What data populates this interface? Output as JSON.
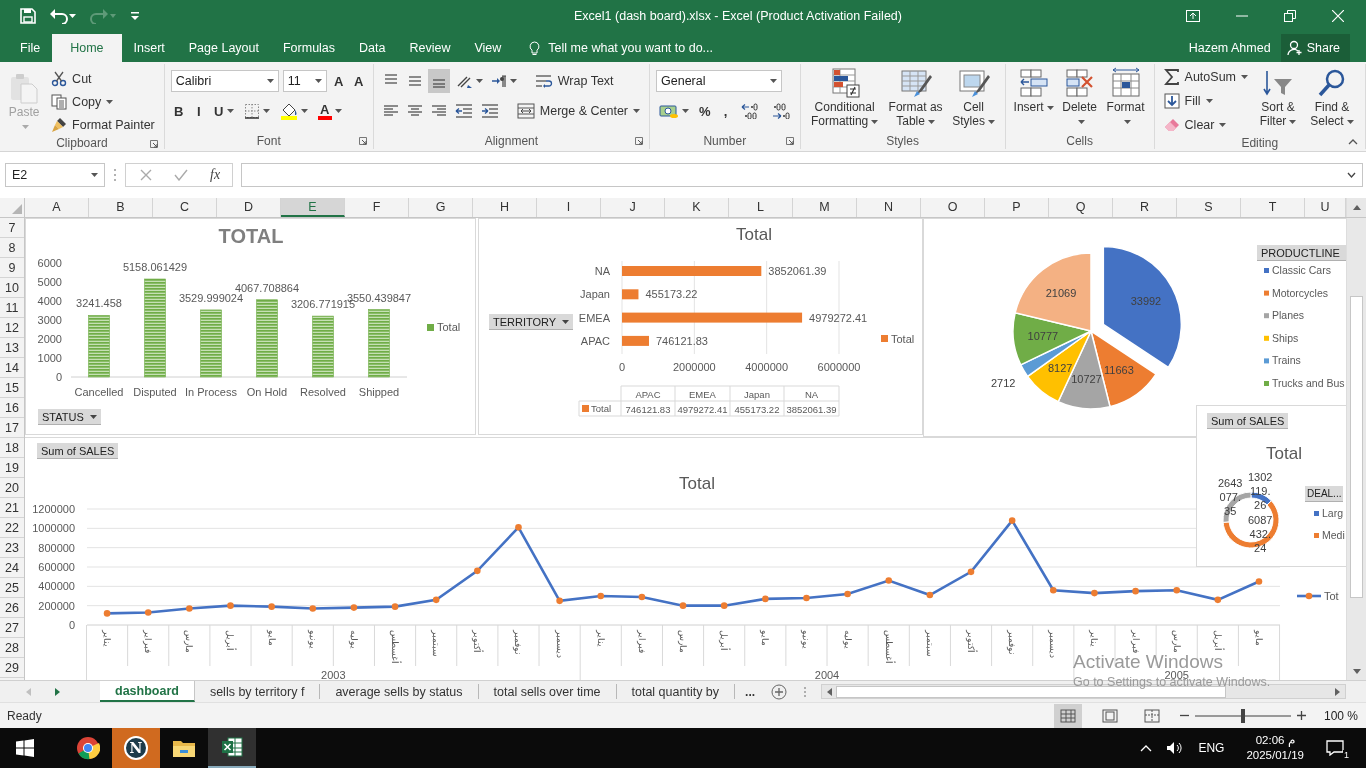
{
  "window": {
    "title": "Excel1 (dash board).xlsx - Excel (Product Activation Failed)",
    "redo_disabled": true
  },
  "tabs": [
    {
      "label": "File",
      "selected": false
    },
    {
      "label": "Home",
      "selected": true
    },
    {
      "label": "Insert",
      "selected": false
    },
    {
      "label": "Page Layout",
      "selected": false
    },
    {
      "label": "Formulas",
      "selected": false
    },
    {
      "label": "Data",
      "selected": false
    },
    {
      "label": "Review",
      "selected": false
    },
    {
      "label": "View",
      "selected": false
    }
  ],
  "tell_me": {
    "placeholder": "Tell me what you want to do..."
  },
  "account": {
    "user": "Hazem Ahmed",
    "share": "Share"
  },
  "ribbon": [
    {
      "label": "Clipboard",
      "launcher": true,
      "stacks": [
        [
          {
            "kind": "big",
            "label": "Paste",
            "dropdown": true,
            "disabled": true
          }
        ],
        [
          {
            "kind": "small",
            "label": "Cut",
            "dropdown": false
          },
          {
            "kind": "small",
            "label": "Copy",
            "dropdown": true
          },
          {
            "kind": "small",
            "label": "Format Painter",
            "dropdown": false
          }
        ]
      ]
    },
    {
      "label": "Font",
      "launcher": true,
      "lines": [
        [
          {
            "kind": "combo",
            "value": "Calibri"
          },
          {
            "kind": "combo",
            "value": "11"
          },
          {
            "kind": "tool",
            "label": "A",
            "dropdown": false
          },
          {
            "kind": "tool",
            "label": "A",
            "dropdown": false
          }
        ],
        [
          {
            "kind": "tool",
            "label": "B",
            "dropdown": false
          },
          {
            "kind": "tool",
            "label": "I",
            "dropdown": false
          },
          {
            "kind": "tool",
            "label": "U",
            "dropdown": true
          },
          {
            "kind": "tool",
            "dropdown": true
          },
          {
            "kind": "tool",
            "dropdown": true
          },
          {
            "kind": "tool",
            "label": "A",
            "dropdown": true
          }
        ]
      ]
    },
    {
      "label": "Alignment",
      "launcher": true,
      "lines": [
        [
          {
            "kind": "tool",
            "dropdown": false,
            "selected": false
          },
          {
            "kind": "tool",
            "dropdown": false,
            "selected": false
          },
          {
            "kind": "tool",
            "dropdown": false,
            "selected": true
          },
          {
            "kind": "tool",
            "dropdown": true
          },
          {
            "kind": "tool",
            "dropdown": true
          },
          {
            "kind": "small",
            "label": "Wrap Text",
            "dropdown": false
          }
        ],
        [
          {
            "kind": "tool",
            "dropdown": false,
            "selected": false
          },
          {
            "kind": "tool",
            "dropdown": false,
            "selected": false
          },
          {
            "kind": "tool",
            "dropdown": false,
            "selected": false
          },
          {
            "kind": "tool",
            "dropdown": false
          },
          {
            "kind": "tool",
            "dropdown": false
          },
          {
            "kind": "small",
            "label": "Merge & Center",
            "dropdown": true
          }
        ]
      ]
    },
    {
      "label": "Number",
      "launcher": true,
      "lines": [
        [
          {
            "kind": "combo",
            "value": "General"
          }
        ],
        [
          {
            "kind": "tool",
            "dropdown": true
          },
          {
            "kind": "tool",
            "label": "%",
            "dropdown": false
          },
          {
            "kind": "tool",
            "label": ",",
            "dropdown": false
          },
          {
            "kind": "tool",
            "dropdown": false
          },
          {
            "kind": "tool",
            "dropdown": false
          }
        ]
      ]
    },
    {
      "label": "Styles",
      "launcher": false,
      "stacks": [
        [
          {
            "kind": "big",
            "label": "Conditional Formatting",
            "dropdown": true
          }
        ],
        [
          {
            "kind": "big",
            "label": "Format as Table",
            "dropdown": true
          }
        ],
        [
          {
            "kind": "big",
            "label": "Cell Styles",
            "dropdown": true
          }
        ]
      ]
    },
    {
      "label": "Cells",
      "launcher": false,
      "stacks": [
        [
          {
            "kind": "big",
            "label": "Insert",
            "dropdown": true
          }
        ],
        [
          {
            "kind": "big",
            "label": "Delete",
            "dropdown": true
          }
        ],
        [
          {
            "kind": "big",
            "label": "Format",
            "dropdown": true
          }
        ]
      ]
    },
    {
      "label": "Editing",
      "launcher": false,
      "stacks": [
        [
          {
            "kind": "small",
            "label": "AutoSum",
            "dropdown": true
          },
          {
            "kind": "small",
            "label": "Fill",
            "dropdown": true
          },
          {
            "kind": "small",
            "label": "Clear",
            "dropdown": true
          }
        ],
        [
          {
            "kind": "big",
            "label": "Sort & Filter",
            "dropdown": true
          }
        ],
        [
          {
            "kind": "big",
            "label": "Find & Select",
            "dropdown": true
          }
        ]
      ]
    }
  ],
  "formula_bar": {
    "name_box": "E2",
    "function_label": "fx"
  },
  "columns": [
    {
      "label": "A",
      "selected": false
    },
    {
      "label": "B",
      "selected": false
    },
    {
      "label": "C",
      "selected": false
    },
    {
      "label": "D",
      "selected": false
    },
    {
      "label": "E",
      "selected": true
    },
    {
      "label": "F",
      "selected": false
    },
    {
      "label": "G",
      "selected": false
    },
    {
      "label": "H",
      "selected": false
    },
    {
      "label": "I",
      "selected": false
    },
    {
      "label": "J",
      "selected": false
    },
    {
      "label": "K",
      "selected": false
    },
    {
      "label": "L",
      "selected": false
    },
    {
      "label": "M",
      "selected": false
    },
    {
      "label": "N",
      "selected": false
    },
    {
      "label": "O",
      "selected": false
    },
    {
      "label": "P",
      "selected": false
    },
    {
      "label": "Q",
      "selected": false
    },
    {
      "label": "R",
      "selected": false
    },
    {
      "label": "S",
      "selected": false
    },
    {
      "label": "T",
      "selected": false
    },
    {
      "label": "U",
      "selected": false
    }
  ],
  "rows": [
    "7",
    "8",
    "9",
    "10",
    "11",
    "12",
    "13",
    "14",
    "15",
    "16",
    "17",
    "18",
    "19",
    "20",
    "21",
    "22",
    "23",
    "24",
    "25",
    "26",
    "27",
    "28",
    "29"
  ],
  "charts": {
    "status": {
      "field_button": "STATUS",
      "chart_data": {
        "type": "bar",
        "title": "TOTAL",
        "categories": [
          "Cancelled",
          "Disputed",
          "In Process",
          "On Hold",
          "Resolved",
          "Shipped"
        ],
        "series": [
          {
            "name": "Total",
            "color": "#70ad47",
            "values": [
              3241.458,
              5158.061429,
              3529.999024,
              4067.708864,
              3206.771915,
              3550.439847
            ]
          }
        ],
        "ylim": [
          0,
          6000
        ],
        "yticks": [
          0,
          1000,
          2000,
          3000,
          4000,
          5000,
          6000
        ],
        "data_labels": true
      }
    },
    "territory": {
      "field_button": "TERRITORY",
      "chart_data": {
        "type": "bar",
        "orientation": "horizontal",
        "title": "Total",
        "categories": [
          "NA",
          "Japan",
          "EMEA",
          "APAC"
        ],
        "series": [
          {
            "name": "Total",
            "color": "#ed7d31",
            "values": [
              3852061.39,
              455173.22,
              4979272.41,
              746121.83
            ]
          }
        ],
        "xlim": [
          0,
          6000000
        ],
        "xticks": [
          0,
          2000000,
          4000000,
          6000000
        ],
        "grid": true,
        "data_labels": true
      },
      "data_table": {
        "columns": [
          "APAC",
          "EMEA",
          "Japan",
          "NA"
        ],
        "row_label": "Total",
        "cells": [
          "746121.83",
          "4979272.41",
          "455173.22",
          "3852061.39"
        ]
      }
    },
    "product": {
      "chart_data": {
        "type": "pie",
        "series": [
          {
            "values": [
              33992,
              11663,
              10727,
              8127,
              2712,
              10777,
              21069
            ]
          }
        ],
        "data_labels": true
      },
      "slices": [
        {
          "color": "#4472c4"
        },
        {
          "color": "#ed7d31"
        },
        {
          "color": "#a5a5a5"
        },
        {
          "color": "#ffc000"
        },
        {
          "color": "#5b9bd5"
        },
        {
          "color": "#70ad47"
        },
        {
          "color": "#f4b183"
        }
      ],
      "legend": {
        "title": "PRODUCTLINE",
        "items": [
          {
            "label": "Classic Cars",
            "color": "#4472c4"
          },
          {
            "label": "Motorcycles",
            "color": "#ed7d31"
          },
          {
            "label": "Planes",
            "color": "#a5a5a5"
          },
          {
            "label": "Ships",
            "color": "#ffc000"
          },
          {
            "label": "Trains",
            "color": "#5b9bd5"
          },
          {
            "label": "Trucks and Bus",
            "color": "#70ad47"
          }
        ]
      }
    },
    "monthly": {
      "field_button": "Sum of SALES",
      "year_labels": [
        "2003",
        "2004",
        "2005"
      ],
      "chart_data": {
        "type": "line",
        "title": "Total",
        "categories": [
          "يناير",
          "فبراير",
          "مارس",
          "أبريل",
          "مايو",
          "يونيو",
          "يوليه",
          "أغسطس",
          "سبتمبر",
          "أكتوبر",
          "نوفمبر",
          "ديسمبر",
          "يناير",
          "فبراير",
          "مارس",
          "أبريل",
          "مايو",
          "يونيو",
          "يوليه",
          "أغسطس",
          "سبتمبر",
          "أكتوبر",
          "نوفمبر",
          "ديسمبر",
          "يناير",
          "فبراير",
          "مارس",
          "أبريل",
          "مايو"
        ],
        "series": [
          {
            "name": "Tot",
            "color": "#4472c4",
            "marker": true,
            "values": [
              120000,
              130000,
              170000,
              200000,
              190000,
              170000,
              180000,
              190000,
              260000,
              560000,
              1010000,
              250000,
              300000,
              290000,
              200000,
              200000,
              270000,
              280000,
              320000,
              460000,
              310000,
              550000,
              1080000,
              360000,
              330000,
              350000,
              360000,
              260000,
              450000
            ]
          }
        ],
        "ylim": [
          0,
          1200000
        ],
        "yticks": [
          0,
          200000,
          400000,
          600000,
          800000,
          1000000,
          1200000
        ],
        "grid": true
      }
    },
    "deal": {
      "field_button": "Sum of SALES",
      "label_lines": [
        [
          "1302",
          "119.",
          "26"
        ],
        [
          "6087",
          "432.",
          "24"
        ],
        [
          "2643",
          "077.",
          "35"
        ]
      ],
      "chart_data": {
        "type": "donut",
        "title": "Total",
        "series": [
          {
            "values": [
              12.98,
              60.68,
              26.34
            ]
          }
        ]
      },
      "slices": [
        {
          "color": "#4472c4"
        },
        {
          "color": "#ed7d31"
        },
        {
          "color": "#a5a5a5"
        }
      ],
      "legend": {
        "title": "DEAL...",
        "items": [
          {
            "label": "Larg",
            "color": "#4472c4"
          },
          {
            "label": "Medi",
            "color": "#ed7d31"
          }
        ]
      }
    }
  },
  "sheet_tabs": [
    {
      "label": "dashboard",
      "selected": true
    },
    {
      "label": "sells by territory f",
      "selected": false
    },
    {
      "label": "average sells by status",
      "selected": false
    },
    {
      "label": "total sells over time",
      "selected": false
    },
    {
      "label": "total quantity by",
      "selected": false
    }
  ],
  "more_tabs": "...",
  "status_bar": {
    "text": "Ready",
    "views": [
      {
        "selected": true
      },
      {
        "selected": false
      },
      {
        "selected": false
      }
    ],
    "zoom": {
      "level": 0.5,
      "reading": "100 %"
    }
  },
  "activation_notice": {
    "title": "Activate Windows",
    "text": "Go to Settings to activate Windows."
  },
  "taskbar": {
    "apps": [
      {
        "kind": "browser",
        "active": false,
        "open": false
      },
      {
        "kind": "letter",
        "label": "N",
        "active": true,
        "open": false
      },
      {
        "kind": "folder",
        "active": false,
        "open": false
      },
      {
        "kind": "sheet",
        "active": false,
        "open": true
      }
    ],
    "language": "ENG",
    "time": "02:06 م",
    "date": "2025/01/19",
    "notifications": "1"
  }
}
